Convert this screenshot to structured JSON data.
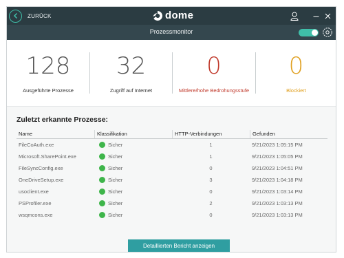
{
  "titlebar": {
    "back_label": "ZURÜCK",
    "brand": "dome"
  },
  "subbar": {
    "title": "Prozessmonitor",
    "toggle_on": true
  },
  "stats": [
    {
      "value": "128",
      "label": "Ausgeführte Prozesse",
      "color": "#555555"
    },
    {
      "value": "32",
      "label": "Zugriff auf Internet",
      "color": "#555555"
    },
    {
      "value": "0",
      "label": "Mittlere/hohe Bedrohungsstufe",
      "color": "#c0392b"
    },
    {
      "value": "0",
      "label": "Blockiert",
      "color": "#e0a020"
    }
  ],
  "section": {
    "title": "Zuletzt erkannte Prozesse:",
    "columns": [
      "Name",
      "Klassifikation",
      "HTTP-Verbindungen",
      "Gefunden"
    ],
    "rows": [
      {
        "name": "FileCoAuth.exe",
        "class": "Sicher",
        "http": "1",
        "found": "9/21/2023 1:05:15 PM"
      },
      {
        "name": "Microsoft.SharePoint.exe",
        "class": "Sicher",
        "http": "1",
        "found": "9/21/2023 1:05:05 PM"
      },
      {
        "name": "FileSyncConfig.exe",
        "class": "Sicher",
        "http": "0",
        "found": "9/21/2023 1:04:51 PM"
      },
      {
        "name": "OneDriveSetup.exe",
        "class": "Sicher",
        "http": "3",
        "found": "9/21/2023 1:04:18 PM"
      },
      {
        "name": "usoclient.exe",
        "class": "Sicher",
        "http": "0",
        "found": "9/21/2023 1:03:14 PM"
      },
      {
        "name": "PSProfiler.exe",
        "class": "Sicher",
        "http": "2",
        "found": "9/21/2023 1:03:13 PM"
      },
      {
        "name": "wsqmcons.exe",
        "class": "Sicher",
        "http": "0",
        "found": "9/21/2023 1:03:13 PM"
      }
    ],
    "button_label": "Detaillierten Bericht anzeigen"
  },
  "colors": {
    "accent": "#3fbfa9",
    "titlebar": "#2b3c42",
    "status_safe": "#3eb54a",
    "button": "#2f9ea1"
  },
  "icons": {
    "back": "arrow-left-circle-icon",
    "logo": "dome-logo-icon",
    "user": "user-icon",
    "minimize": "minimize-icon",
    "close": "close-icon",
    "settings": "gear-icon"
  }
}
